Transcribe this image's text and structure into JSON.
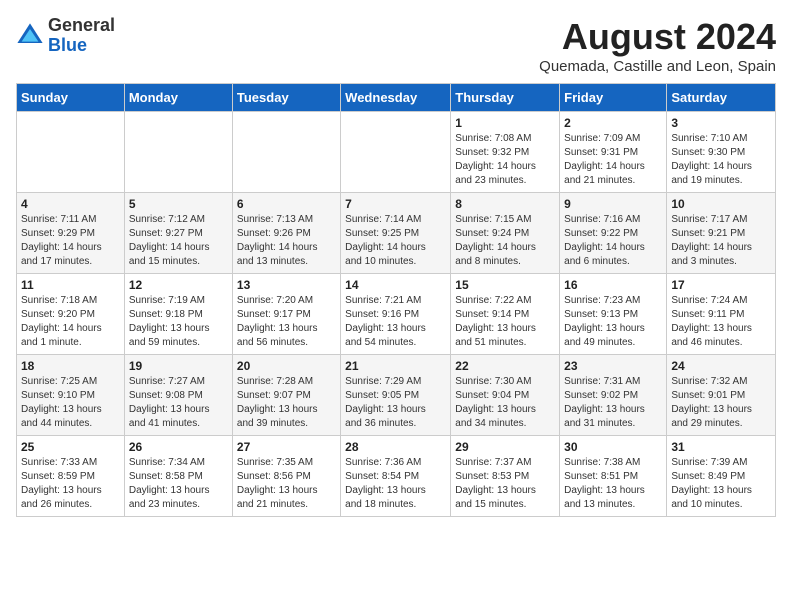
{
  "logo": {
    "general": "General",
    "blue": "Blue"
  },
  "title": "August 2024",
  "subtitle": "Quemada, Castille and Leon, Spain",
  "headers": [
    "Sunday",
    "Monday",
    "Tuesday",
    "Wednesday",
    "Thursday",
    "Friday",
    "Saturday"
  ],
  "weeks": [
    [
      {
        "day": "",
        "info": ""
      },
      {
        "day": "",
        "info": ""
      },
      {
        "day": "",
        "info": ""
      },
      {
        "day": "",
        "info": ""
      },
      {
        "day": "1",
        "info": "Sunrise: 7:08 AM\nSunset: 9:32 PM\nDaylight: 14 hours\nand 23 minutes."
      },
      {
        "day": "2",
        "info": "Sunrise: 7:09 AM\nSunset: 9:31 PM\nDaylight: 14 hours\nand 21 minutes."
      },
      {
        "day": "3",
        "info": "Sunrise: 7:10 AM\nSunset: 9:30 PM\nDaylight: 14 hours\nand 19 minutes."
      }
    ],
    [
      {
        "day": "4",
        "info": "Sunrise: 7:11 AM\nSunset: 9:29 PM\nDaylight: 14 hours\nand 17 minutes."
      },
      {
        "day": "5",
        "info": "Sunrise: 7:12 AM\nSunset: 9:27 PM\nDaylight: 14 hours\nand 15 minutes."
      },
      {
        "day": "6",
        "info": "Sunrise: 7:13 AM\nSunset: 9:26 PM\nDaylight: 14 hours\nand 13 minutes."
      },
      {
        "day": "7",
        "info": "Sunrise: 7:14 AM\nSunset: 9:25 PM\nDaylight: 14 hours\nand 10 minutes."
      },
      {
        "day": "8",
        "info": "Sunrise: 7:15 AM\nSunset: 9:24 PM\nDaylight: 14 hours\nand 8 minutes."
      },
      {
        "day": "9",
        "info": "Sunrise: 7:16 AM\nSunset: 9:22 PM\nDaylight: 14 hours\nand 6 minutes."
      },
      {
        "day": "10",
        "info": "Sunrise: 7:17 AM\nSunset: 9:21 PM\nDaylight: 14 hours\nand 3 minutes."
      }
    ],
    [
      {
        "day": "11",
        "info": "Sunrise: 7:18 AM\nSunset: 9:20 PM\nDaylight: 14 hours\nand 1 minute."
      },
      {
        "day": "12",
        "info": "Sunrise: 7:19 AM\nSunset: 9:18 PM\nDaylight: 13 hours\nand 59 minutes."
      },
      {
        "day": "13",
        "info": "Sunrise: 7:20 AM\nSunset: 9:17 PM\nDaylight: 13 hours\nand 56 minutes."
      },
      {
        "day": "14",
        "info": "Sunrise: 7:21 AM\nSunset: 9:16 PM\nDaylight: 13 hours\nand 54 minutes."
      },
      {
        "day": "15",
        "info": "Sunrise: 7:22 AM\nSunset: 9:14 PM\nDaylight: 13 hours\nand 51 minutes."
      },
      {
        "day": "16",
        "info": "Sunrise: 7:23 AM\nSunset: 9:13 PM\nDaylight: 13 hours\nand 49 minutes."
      },
      {
        "day": "17",
        "info": "Sunrise: 7:24 AM\nSunset: 9:11 PM\nDaylight: 13 hours\nand 46 minutes."
      }
    ],
    [
      {
        "day": "18",
        "info": "Sunrise: 7:25 AM\nSunset: 9:10 PM\nDaylight: 13 hours\nand 44 minutes."
      },
      {
        "day": "19",
        "info": "Sunrise: 7:27 AM\nSunset: 9:08 PM\nDaylight: 13 hours\nand 41 minutes."
      },
      {
        "day": "20",
        "info": "Sunrise: 7:28 AM\nSunset: 9:07 PM\nDaylight: 13 hours\nand 39 minutes."
      },
      {
        "day": "21",
        "info": "Sunrise: 7:29 AM\nSunset: 9:05 PM\nDaylight: 13 hours\nand 36 minutes."
      },
      {
        "day": "22",
        "info": "Sunrise: 7:30 AM\nSunset: 9:04 PM\nDaylight: 13 hours\nand 34 minutes."
      },
      {
        "day": "23",
        "info": "Sunrise: 7:31 AM\nSunset: 9:02 PM\nDaylight: 13 hours\nand 31 minutes."
      },
      {
        "day": "24",
        "info": "Sunrise: 7:32 AM\nSunset: 9:01 PM\nDaylight: 13 hours\nand 29 minutes."
      }
    ],
    [
      {
        "day": "25",
        "info": "Sunrise: 7:33 AM\nSunset: 8:59 PM\nDaylight: 13 hours\nand 26 minutes."
      },
      {
        "day": "26",
        "info": "Sunrise: 7:34 AM\nSunset: 8:58 PM\nDaylight: 13 hours\nand 23 minutes."
      },
      {
        "day": "27",
        "info": "Sunrise: 7:35 AM\nSunset: 8:56 PM\nDaylight: 13 hours\nand 21 minutes."
      },
      {
        "day": "28",
        "info": "Sunrise: 7:36 AM\nSunset: 8:54 PM\nDaylight: 13 hours\nand 18 minutes."
      },
      {
        "day": "29",
        "info": "Sunrise: 7:37 AM\nSunset: 8:53 PM\nDaylight: 13 hours\nand 15 minutes."
      },
      {
        "day": "30",
        "info": "Sunrise: 7:38 AM\nSunset: 8:51 PM\nDaylight: 13 hours\nand 13 minutes."
      },
      {
        "day": "31",
        "info": "Sunrise: 7:39 AM\nSunset: 8:49 PM\nDaylight: 13 hours\nand 10 minutes."
      }
    ]
  ]
}
